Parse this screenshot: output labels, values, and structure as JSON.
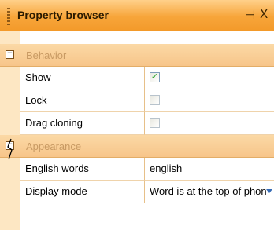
{
  "panel": {
    "title": "Property browser",
    "pin_glyph": "⊣",
    "close_glyph": "X"
  },
  "categories": [
    {
      "label": "Behavior",
      "expanded_symbol": "−",
      "properties": [
        {
          "name": "Show",
          "type": "checkbox",
          "checked": true
        },
        {
          "name": "Lock",
          "type": "checkbox",
          "checked": false
        },
        {
          "name": "Drag cloning",
          "type": "checkbox",
          "checked": false
        }
      ]
    },
    {
      "label": "Appearance",
      "expanded_symbol": "−",
      "properties": [
        {
          "name": "English words",
          "type": "text",
          "value": "english"
        },
        {
          "name": "Display mode",
          "type": "dropdown",
          "value": "Word is at the top of phon"
        }
      ]
    }
  ],
  "colors": {
    "titlebar": "#f7a53a",
    "category_band": "#f7c58a",
    "gutter": "#fde7c3",
    "grid_line": "#efd3ab"
  }
}
